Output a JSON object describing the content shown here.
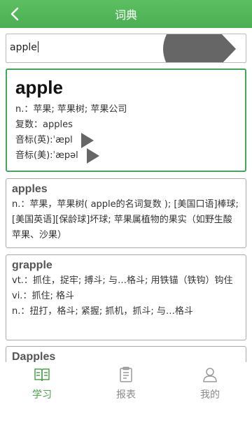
{
  "header": {
    "title": "词典"
  },
  "search": {
    "value": "apple"
  },
  "main_entry": {
    "word": "apple",
    "pos_line": "n.：苹果; 苹果树; 苹果公司",
    "plural_line": "复数：apples",
    "uk_phonetic": "音标(英):ˈæpl",
    "us_phonetic": "音标(美):ˈæpəl"
  },
  "results": [
    {
      "headword": "apples",
      "definition": "n.：苹果，苹果树( apple的名词复数 ); [美国口语]棒球; [美国英语][保龄球]坏球; 苹果属植物的果实（如野生酸苹果、沙果）"
    },
    {
      "headword": "grapple",
      "definition": "vt.：抓住，捉牢; 搏斗; 与…格斗; 用铁锚（铁钩）钩住\nvi.：抓住; 格斗\nn.：扭打，格斗; 紧握; 抓机，抓斗; 与…格斗"
    },
    {
      "headword": "Dapples",
      "definition": ""
    }
  ],
  "tabs": [
    {
      "label": "学习",
      "icon": "book-icon",
      "active": true
    },
    {
      "label": "报表",
      "icon": "clipboard-icon",
      "active": false
    },
    {
      "label": "我的",
      "icon": "user-icon",
      "active": false
    }
  ],
  "colors": {
    "header": "#4cae52",
    "accent": "#3fa65a",
    "active_tab": "#4aa34f",
    "inactive_tab": "#8a8a8a"
  }
}
